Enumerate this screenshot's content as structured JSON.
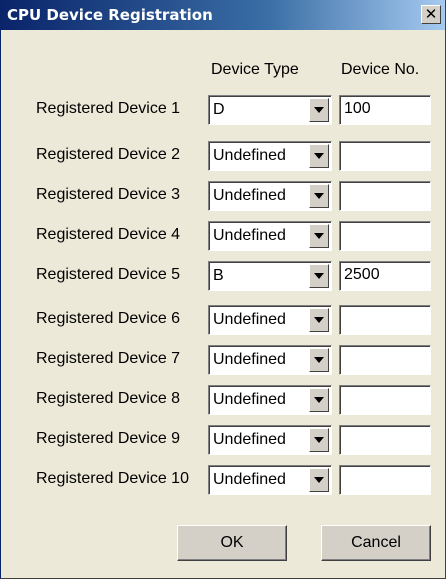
{
  "window": {
    "title": "CPU Device Registration",
    "close_glyph": "✕"
  },
  "headers": {
    "device_type": "Device Type",
    "device_no": "Device No."
  },
  "rows": [
    {
      "label": "Registered Device 1",
      "type": "D",
      "number": "100"
    },
    {
      "label": "Registered Device 2",
      "type": "Undefined",
      "number": ""
    },
    {
      "label": "Registered Device 3",
      "type": "Undefined",
      "number": ""
    },
    {
      "label": "Registered Device 4",
      "type": "Undefined",
      "number": ""
    },
    {
      "label": "Registered Device 5",
      "type": "B",
      "number": "2500"
    },
    {
      "label": "Registered Device 6",
      "type": "Undefined",
      "number": ""
    },
    {
      "label": "Registered Device 7",
      "type": "Undefined",
      "number": ""
    },
    {
      "label": "Registered Device 8",
      "type": "Undefined",
      "number": ""
    },
    {
      "label": "Registered Device 9",
      "type": "Undefined",
      "number": ""
    },
    {
      "label": "Registered Device 10",
      "type": "Undefined",
      "number": ""
    }
  ],
  "buttons": {
    "ok": "OK",
    "cancel": "Cancel"
  }
}
